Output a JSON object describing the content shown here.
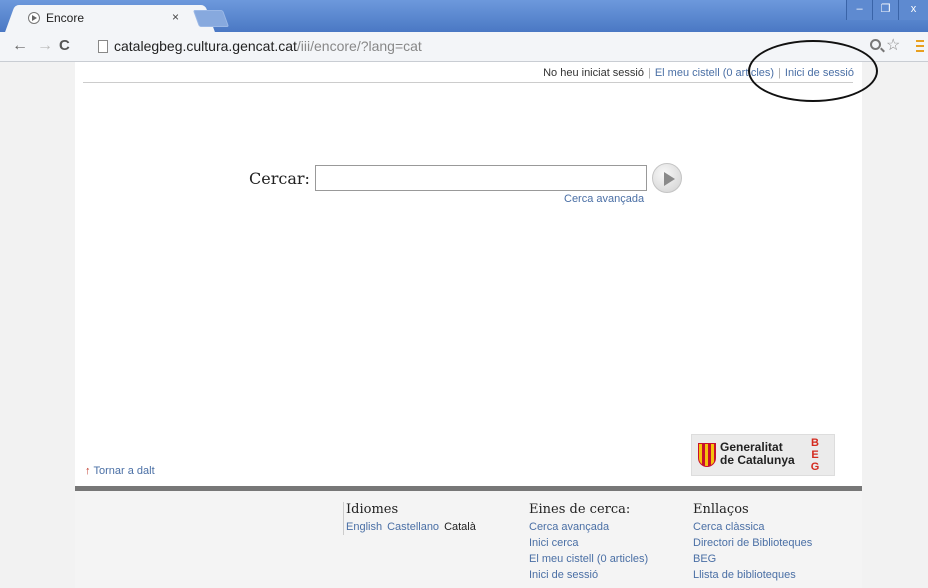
{
  "browser": {
    "tab_title": "Encore",
    "tab_close": "×",
    "url_host": "catalegbeg.cultura.gencat.cat",
    "url_path": "/iii/encore/?lang=cat",
    "window_buttons": {
      "minimize": "–",
      "maximize": "❐",
      "close": "x"
    }
  },
  "header": {
    "session_status": "No heu iniciat sessió",
    "basket_link": "El meu cistell (0 articles)",
    "login_link": "Inici de sessió"
  },
  "search": {
    "label": "Cercar:",
    "value": "",
    "advanced_link": "Cerca avançada"
  },
  "back_to_top": {
    "arrow": "↑",
    "label": "Tornar a dalt"
  },
  "logo": {
    "line1": "Generalitat",
    "line2": "de Catalunya",
    "beg": [
      "B",
      "E",
      "G"
    ]
  },
  "footer": {
    "idiomes": {
      "title": "Idiomes",
      "languages": [
        "English",
        "Castellano",
        "Català"
      ]
    },
    "eines": {
      "title": "Eines de cerca:",
      "links": [
        "Cerca avançada",
        "Inici cerca",
        "El meu cistell (0 articles)",
        "Inici de sessió"
      ]
    },
    "enllacos": {
      "title": "Enllaços",
      "links": [
        "Cerca clàssica",
        "Directori de Biblioteques",
        "BEG",
        "Llista de biblioteques"
      ]
    }
  },
  "colors": {
    "link": "#4a6fa5",
    "titlebar": "#4a78c4",
    "accent_red": "#d42a1e"
  }
}
